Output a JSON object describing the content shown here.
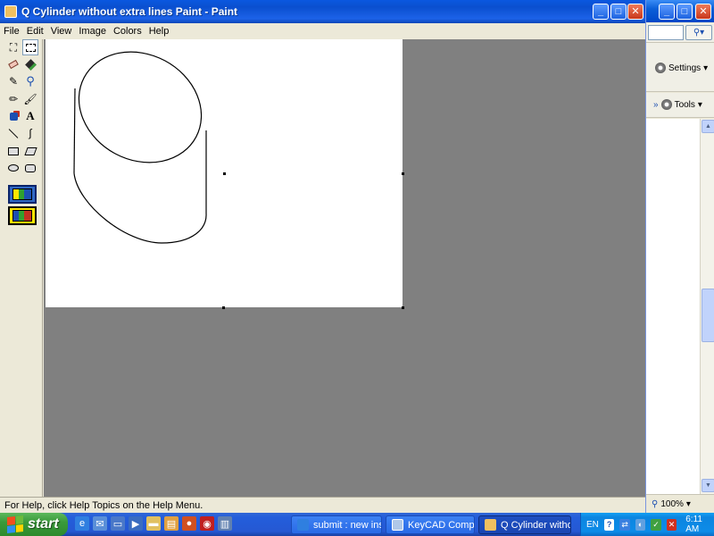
{
  "paint": {
    "title": "Q Cylinder without extra lines Paint - Paint",
    "menu": [
      "File",
      "Edit",
      "View",
      "Image",
      "Colors",
      "Help"
    ],
    "status": "For Help, click Help Topics on the Help Menu."
  },
  "browser": {
    "settings_label": "Settings",
    "tools_label": "Tools",
    "zoom": "100%"
  },
  "taskbar": {
    "start_label": "start",
    "tasks": [
      {
        "label": "submit : new ins..."
      },
      {
        "label": "KeyCAD Complete"
      },
      {
        "label": "Q Cylinder witho..."
      }
    ],
    "language": "EN",
    "clock": "6:11 AM"
  },
  "colors": {
    "titlebar": "#0a58e0",
    "workspace": "#808080",
    "window_face": "#ece9d8",
    "start_green": "#3a9a3a"
  },
  "icons": {
    "tools": [
      "free-select-icon",
      "rect-select-icon",
      "eraser-icon",
      "fill-icon",
      "color-picker-icon",
      "magnifier-icon",
      "pencil-icon",
      "brush-icon",
      "airbrush-icon",
      "text-icon",
      "line-icon",
      "curve-icon",
      "rectangle-icon",
      "polygon-icon",
      "ellipse-icon",
      "rounded-rect-icon"
    ]
  }
}
